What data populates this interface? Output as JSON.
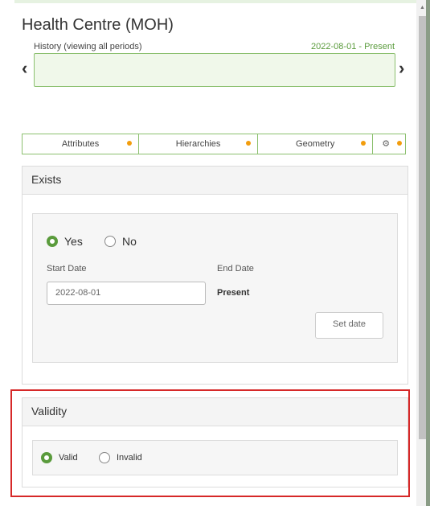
{
  "page": {
    "title": "Health Centre (MOH)"
  },
  "history": {
    "label": "History (viewing all periods)",
    "range": "2022-08-01 - Present",
    "prev_arrow": "‹",
    "next_arrow": "›"
  },
  "tabs": [
    {
      "label": "Attributes",
      "status": "changed"
    },
    {
      "label": "Hierarchies",
      "status": "changed"
    },
    {
      "label": "Geometry",
      "status": "changed"
    },
    {
      "label": "",
      "icon": "gear-icon",
      "status": "changed"
    }
  ],
  "exists": {
    "header": "Exists",
    "options": [
      {
        "label": "Yes",
        "checked": true
      },
      {
        "label": "No",
        "checked": false
      }
    ],
    "start_date_label": "Start Date",
    "end_date_label": "End Date",
    "start_date_value": "2022-08-01",
    "end_date_value": "Present",
    "set_date_button": "Set date"
  },
  "validity": {
    "header": "Validity",
    "options": [
      {
        "label": "Valid",
        "checked": true
      },
      {
        "label": "Invalid",
        "checked": false
      }
    ]
  },
  "colors": {
    "accent_green": "#5a9b3c",
    "history_border": "#8cc06f",
    "dot_orange": "#f29d0d",
    "highlight_red": "#d62828"
  }
}
